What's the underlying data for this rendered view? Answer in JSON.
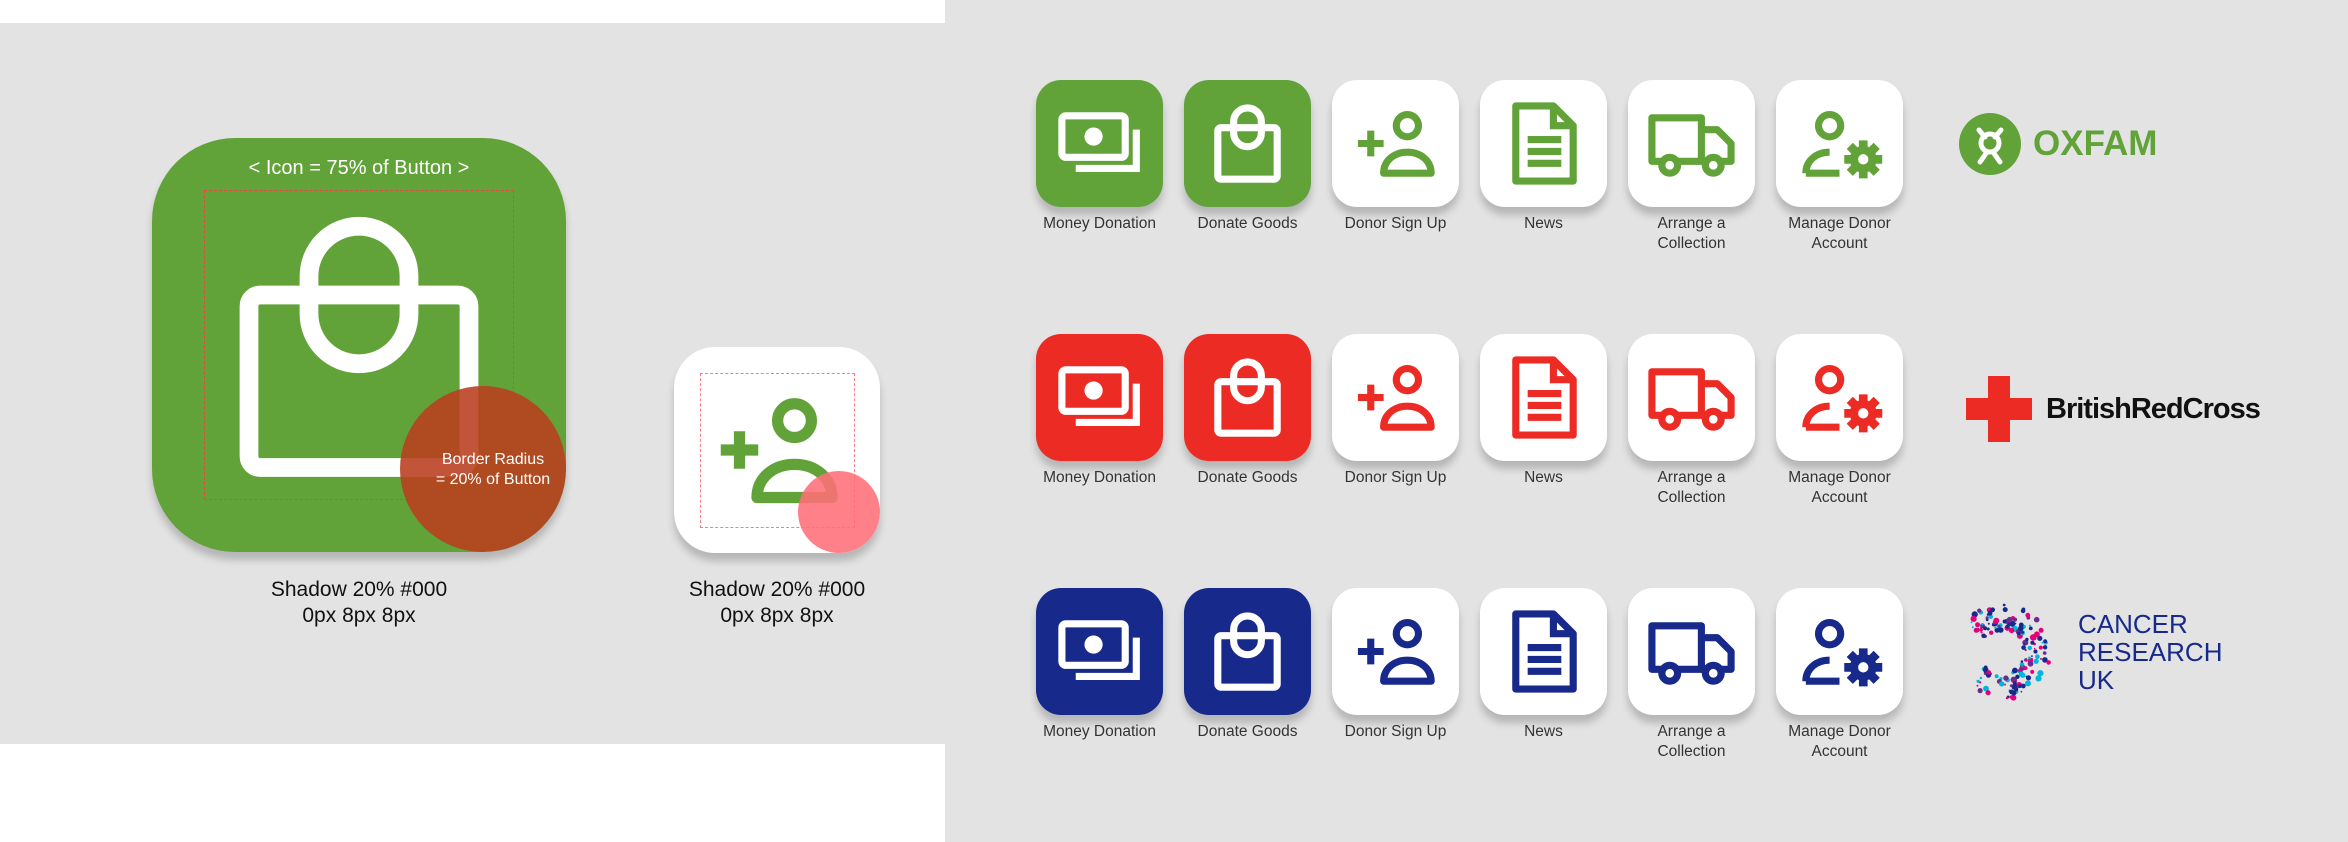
{
  "colors": {
    "oxfam_green": "#62a339",
    "red_cross": "#ec2b24",
    "cancer_navy": "#17298a",
    "panel_bg": "#e3e3e3",
    "white": "#ffffff",
    "guide_red": "#e8483f",
    "guide_pink": "#ff7b82",
    "radius_circle_brown": "#b94d1f"
  },
  "spec": {
    "large_button_icon": "shopping-bag-icon",
    "small_button_icon": "person-add-icon",
    "icon_scale_label": "< Icon = 75% of Button >",
    "radius_label_line1": "Border Radius",
    "radius_label_line2": "= 20% of Button",
    "shadow_line1": "Shadow 20% #000",
    "shadow_line2": "0px 8px 8px"
  },
  "icons": [
    {
      "icon": "money-icon",
      "line1": "Money Donation",
      "line2": ""
    },
    {
      "icon": "shopping-bag-icon",
      "line1": "Donate Goods",
      "line2": ""
    },
    {
      "icon": "person-add-icon",
      "line1": "Donor Sign Up",
      "line2": ""
    },
    {
      "icon": "news-icon",
      "line1": "News",
      "line2": ""
    },
    {
      "icon": "truck-icon",
      "line1": "Arrange a",
      "line2": "Collection"
    },
    {
      "icon": "person-settings-icon",
      "line1": "Manage Donor",
      "line2": "Account"
    }
  ],
  "brands": [
    {
      "name": "OXFAM",
      "logo": "oxfam-logo",
      "color": "#62a339",
      "filled_tiles": 2
    },
    {
      "name": "BritishRedCross",
      "logo": "red-cross-logo",
      "color": "#ec2b24",
      "filled_tiles": 2
    },
    {
      "name_line1": "CANCER",
      "name_line2": "RESEARCH",
      "name_line3": "UK",
      "logo": "cancer-research-uk-logo",
      "color": "#17298a",
      "filled_tiles": 2
    }
  ]
}
